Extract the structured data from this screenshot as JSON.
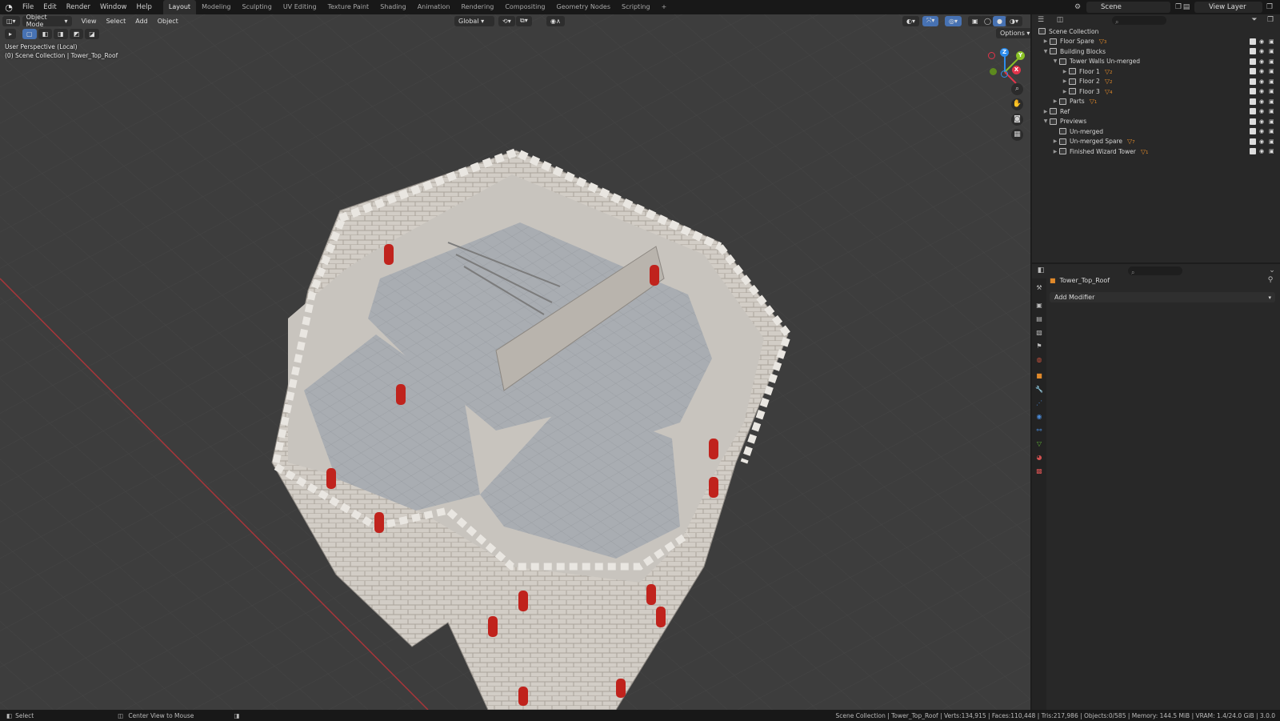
{
  "menu": [
    "File",
    "Edit",
    "Render",
    "Window",
    "Help"
  ],
  "workspaces": [
    "Layout",
    "Modeling",
    "Sculpting",
    "UV Editing",
    "Texture Paint",
    "Shading",
    "Animation",
    "Rendering",
    "Compositing",
    "Geometry Nodes",
    "Scripting"
  ],
  "active_workspace": "Layout",
  "scene_name": "Scene",
  "view_layer": "View Layer",
  "viewport": {
    "mode": "Object Mode",
    "menus": [
      "View",
      "Select",
      "Add",
      "Object"
    ],
    "transform_orientation": "Global",
    "options_label": "Options",
    "perspective_label": "User Perspective (Local)",
    "collection_label": "(0) Scene Collection | Tower_Top_Roof",
    "gizmo": {
      "x": "X",
      "y": "Y",
      "z": "Z"
    }
  },
  "outliner": {
    "root": "Scene Collection",
    "rows": [
      {
        "label": "Floor Spare",
        "depth": 1,
        "expand": "closed",
        "badge": "3"
      },
      {
        "label": "Building Blocks",
        "depth": 1,
        "expand": "open",
        "badge": ""
      },
      {
        "label": "Tower Walls Un-merged",
        "depth": 2,
        "expand": "open",
        "badge": ""
      },
      {
        "label": "Floor 1",
        "depth": 3,
        "expand": "closed",
        "badge": "2"
      },
      {
        "label": "Floor 2",
        "depth": 3,
        "expand": "closed",
        "badge": "2"
      },
      {
        "label": "Floor 3",
        "depth": 3,
        "expand": "closed",
        "badge": "4"
      },
      {
        "label": "Parts",
        "depth": 2,
        "expand": "closed",
        "badge": "1"
      },
      {
        "label": "Ref",
        "depth": 1,
        "expand": "closed",
        "badge": ""
      },
      {
        "label": "Previews",
        "depth": 1,
        "expand": "open",
        "badge": ""
      },
      {
        "label": "Un-merged",
        "depth": 2,
        "expand": "none",
        "badge": ""
      },
      {
        "label": "Un-merged Spare",
        "depth": 2,
        "expand": "closed",
        "badge": "7"
      },
      {
        "label": "Finished Wizard Tower",
        "depth": 2,
        "expand": "closed",
        "badge": "1"
      }
    ]
  },
  "properties": {
    "object_name": "Tower_Top_Roof",
    "add_modifier": "Add Modifier"
  },
  "status": {
    "select": "Select",
    "center_view": "Center View to Mouse",
    "stats": "Scene Collection | Tower_Top_Roof | Verts:134,915 | Faces:110,448 | Tris:217,986 | Objects:0/585 | Memory: 144.5 MiB | VRAM: 1.4/24.0 GiB | 3.0.0"
  },
  "colors": {
    "accent": "#4772b3",
    "mesh_badge": "#e0892a",
    "axis_x": "#e2344a",
    "axis_y": "#8ac226",
    "axis_z": "#2d8ceb",
    "window_red": "#c0231d"
  }
}
